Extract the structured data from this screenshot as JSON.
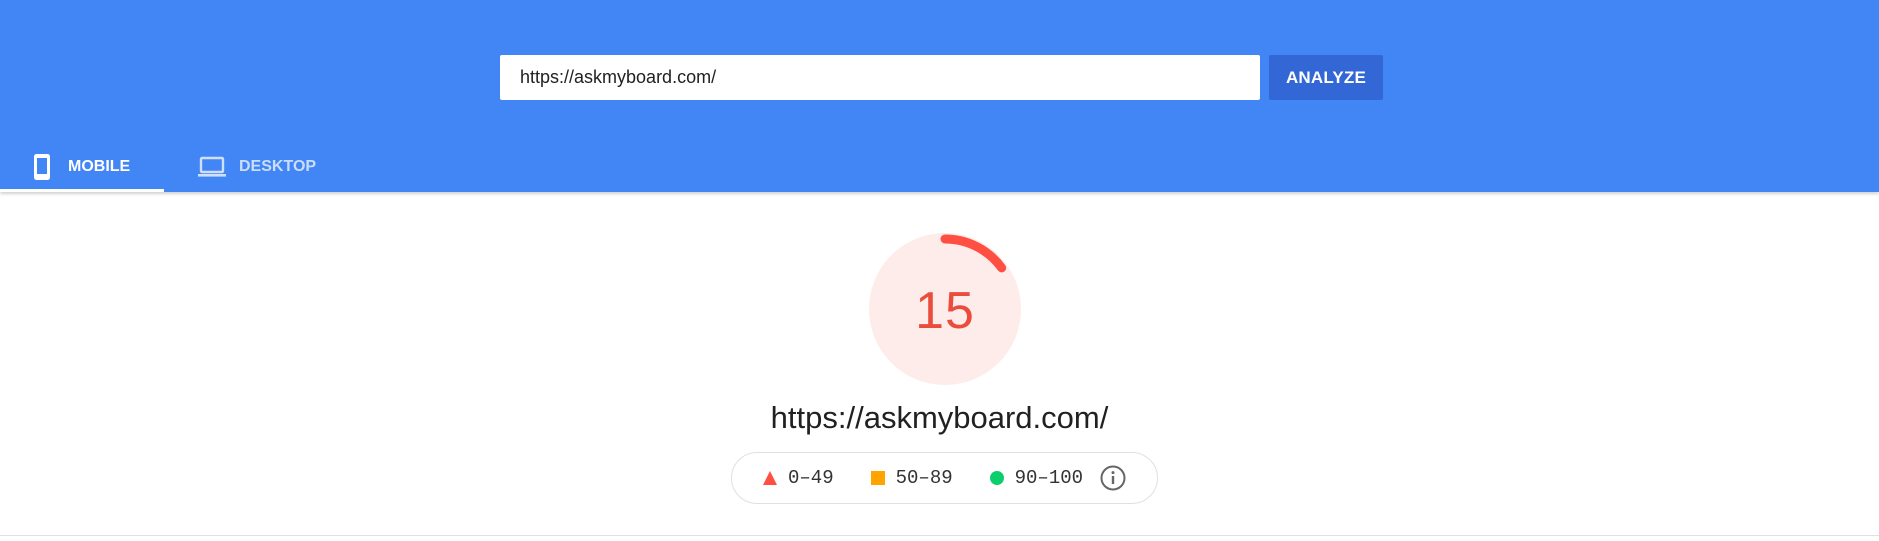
{
  "header": {
    "url_value": "https://askmyboard.com/",
    "analyze_label": "ANALYZE",
    "bg_color": "#4285f4"
  },
  "tabs": [
    {
      "label": "MOBILE",
      "icon": "smartphone-icon",
      "active": true
    },
    {
      "label": "DESKTOP",
      "icon": "laptop-icon",
      "active": false
    }
  ],
  "report": {
    "score": "15",
    "score_fraction": 0.15,
    "score_color": "#ff4e42",
    "url": "https://askmyboard.com/"
  },
  "legend": [
    {
      "range": "0–49",
      "icon": "red-triangle-icon",
      "color": "#ff4e42"
    },
    {
      "range": "50–89",
      "icon": "orange-square-icon",
      "color": "#ffa400"
    },
    {
      "range": "90–100",
      "icon": "green-circle-icon",
      "color": "#0cce6b"
    }
  ],
  "legend_info_icon": "info-icon"
}
